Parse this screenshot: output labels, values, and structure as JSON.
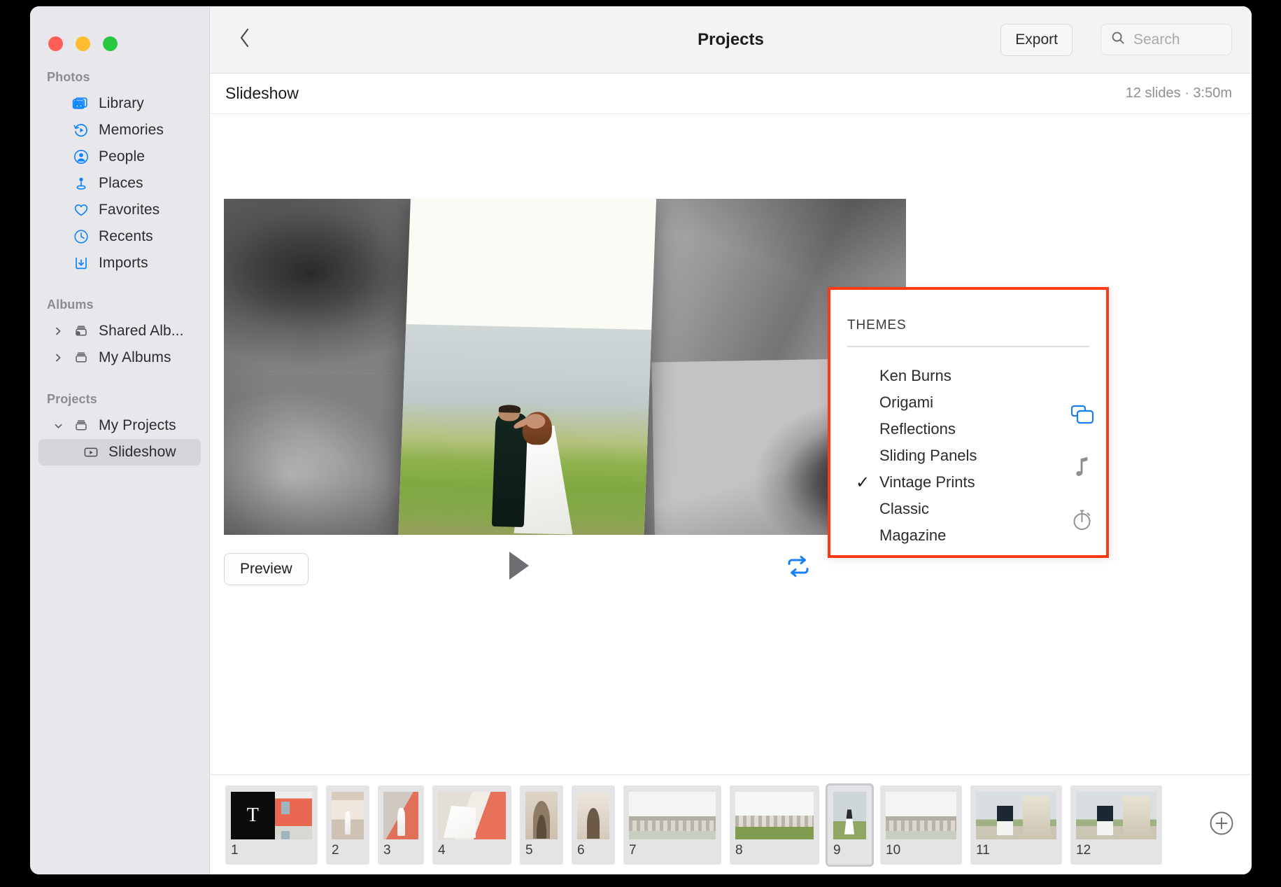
{
  "window": {
    "traffic_lights": [
      "close",
      "minimize",
      "zoom"
    ]
  },
  "sidebar": {
    "groups": [
      {
        "title": "Photos",
        "items": [
          {
            "label": "Library",
            "icon": "library-icon",
            "selected": false
          },
          {
            "label": "Memories",
            "icon": "memories-icon",
            "selected": false
          },
          {
            "label": "People",
            "icon": "people-icon",
            "selected": false
          },
          {
            "label": "Places",
            "icon": "places-icon",
            "selected": false
          },
          {
            "label": "Favorites",
            "icon": "heart-icon",
            "selected": false
          },
          {
            "label": "Recents",
            "icon": "clock-icon",
            "selected": false
          },
          {
            "label": "Imports",
            "icon": "imports-icon",
            "selected": false
          }
        ]
      },
      {
        "title": "Albums",
        "items": [
          {
            "label": "Shared Alb...",
            "icon": "shared-album-icon",
            "selected": false,
            "disclosure": "collapsed"
          },
          {
            "label": "My Albums",
            "icon": "album-icon",
            "selected": false,
            "disclosure": "collapsed"
          }
        ]
      },
      {
        "title": "Projects",
        "items": [
          {
            "label": "My Projects",
            "icon": "album-icon",
            "selected": false,
            "disclosure": "expanded"
          },
          {
            "label": "Slideshow",
            "icon": "slideshow-icon",
            "selected": true,
            "child": true
          }
        ]
      }
    ]
  },
  "toolbar": {
    "back_icon": "chevron-left-icon",
    "title": "Projects",
    "export_label": "Export",
    "search_icon": "search-icon",
    "search_placeholder": "Search",
    "search_value": ""
  },
  "subheader": {
    "title": "Slideshow",
    "meta": "12 slides · 3:50m"
  },
  "controls": {
    "preview_label": "Preview",
    "play_icon": "play-icon",
    "loop_icon": "loop-icon",
    "loop_color": "#1a7ef5"
  },
  "themes_panel": {
    "heading": "THEMES",
    "border_color": "#f93a12",
    "selected": "Vintage Prints",
    "check_glyph": "✓",
    "items": [
      {
        "label": "Ken Burns",
        "checked": false
      },
      {
        "label": "Origami",
        "checked": false
      },
      {
        "label": "Reflections",
        "checked": false
      },
      {
        "label": "Sliding Panels",
        "checked": false
      },
      {
        "label": "Vintage Prints",
        "checked": true
      },
      {
        "label": "Classic",
        "checked": false
      },
      {
        "label": "Magazine",
        "checked": false
      }
    ],
    "side_icons": [
      {
        "name": "transitions-icon",
        "active": true,
        "color": "#1a7ef5"
      },
      {
        "name": "music-note-icon",
        "active": false,
        "color": "#8e8e93"
      },
      {
        "name": "duration-timer-icon",
        "active": false,
        "color": "#8e8e93"
      }
    ]
  },
  "filmstrip": {
    "add_icon": "plus-circle-icon",
    "slides": [
      {
        "number": "1",
        "kind": "title-card",
        "selected": false
      },
      {
        "number": "2",
        "kind": "corridor",
        "selected": false
      },
      {
        "number": "3",
        "kind": "street",
        "selected": false
      },
      {
        "number": "4",
        "kind": "veil",
        "selected": false
      },
      {
        "number": "5",
        "kind": "arch",
        "selected": false
      },
      {
        "number": "6",
        "kind": "gate",
        "selected": false
      },
      {
        "number": "7",
        "kind": "balustrade",
        "selected": false
      },
      {
        "number": "8",
        "kind": "balustrade-green",
        "selected": false
      },
      {
        "number": "9",
        "kind": "field",
        "selected": true
      },
      {
        "number": "10",
        "kind": "balustrade",
        "selected": false
      },
      {
        "number": "11",
        "kind": "sea",
        "selected": false
      },
      {
        "number": "12",
        "kind": "sea",
        "selected": false
      }
    ]
  },
  "preview": {
    "theme_applied": "Vintage Prints",
    "description": "Tilted white photo print of a bride and groom over a collage of black-and-white wedding photos"
  }
}
